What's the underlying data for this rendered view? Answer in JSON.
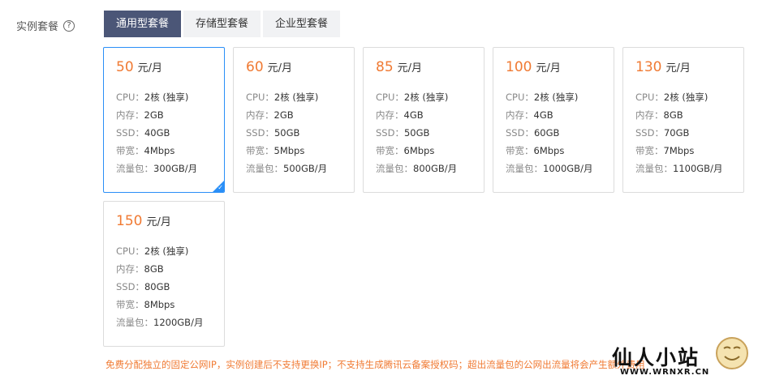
{
  "label": {
    "text": "实例套餐",
    "help": "?"
  },
  "tabs": [
    {
      "label": "通用型套餐",
      "active": true
    },
    {
      "label": "存储型套餐",
      "active": false
    },
    {
      "label": "企业型套餐",
      "active": false
    }
  ],
  "spec_keys": {
    "cpu": "CPU：",
    "mem": "内存：",
    "ssd": "SSD：",
    "bw": "带宽：",
    "traffic": "流量包："
  },
  "plans": [
    {
      "price": "50",
      "unit": "元/月",
      "cpu": "2核 (独享)",
      "mem": "2GB",
      "ssd": "40GB",
      "bw": "4Mbps",
      "traffic": "300GB/月",
      "selected": true
    },
    {
      "price": "60",
      "unit": "元/月",
      "cpu": "2核 (独享)",
      "mem": "2GB",
      "ssd": "50GB",
      "bw": "5Mbps",
      "traffic": "500GB/月",
      "selected": false
    },
    {
      "price": "85",
      "unit": "元/月",
      "cpu": "2核 (独享)",
      "mem": "4GB",
      "ssd": "50GB",
      "bw": "6Mbps",
      "traffic": "800GB/月",
      "selected": false
    },
    {
      "price": "100",
      "unit": "元/月",
      "cpu": "2核 (独享)",
      "mem": "4GB",
      "ssd": "60GB",
      "bw": "6Mbps",
      "traffic": "1000GB/月",
      "selected": false
    },
    {
      "price": "130",
      "unit": "元/月",
      "cpu": "2核 (独享)",
      "mem": "8GB",
      "ssd": "70GB",
      "bw": "7Mbps",
      "traffic": "1100GB/月",
      "selected": false
    },
    {
      "price": "150",
      "unit": "元/月",
      "cpu": "2核 (独享)",
      "mem": "8GB",
      "ssd": "80GB",
      "bw": "8Mbps",
      "traffic": "1200GB/月",
      "selected": false
    }
  ],
  "notice": "免费分配独立的固定公网IP，实例创建后不支持更换IP；不支持生成腾讯云备案授权码；超出流量包的公网出流量将会产生额外费用",
  "watermark": {
    "title": "仙人小站",
    "url": "WWW.WRNXR.CN"
  },
  "colors": {
    "accent": "#f07a33",
    "tab_active": "#4b5677",
    "selected_border": "#2a8ff7"
  }
}
